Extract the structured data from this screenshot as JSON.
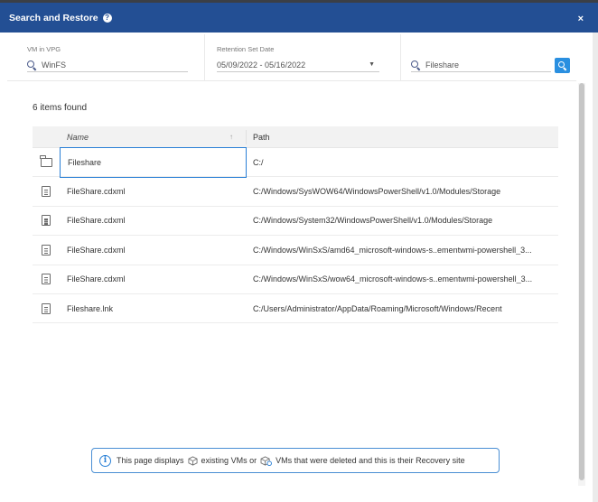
{
  "dialog": {
    "title": "Search and Restore",
    "help_glyph": "?",
    "close_glyph": "×"
  },
  "filters": {
    "vm_label": "VM in VPG",
    "vm_value": "WinFS",
    "date_label": "Retention Set Date",
    "date_value": "05/09/2022 - 05/16/2022",
    "search_value": "Fileshare"
  },
  "results": {
    "count_text": "6 items found",
    "columns": {
      "name": "Name",
      "path": "Path"
    },
    "rows": [
      {
        "type": "folder",
        "name": "Fileshare",
        "path": "C:/"
      },
      {
        "type": "file",
        "name": "FileShare.cdxml",
        "path": "C:/Windows/SysWOW64/WindowsPowerShell/v1.0/Modules/Storage"
      },
      {
        "type": "file",
        "name": "FileShare.cdxml",
        "path": "C:/Windows/System32/WindowsPowerShell/v1.0/Modules/Storage"
      },
      {
        "type": "file",
        "name": "FileShare.cdxml",
        "path": "C:/Windows/WinSxS/amd64_microsoft-windows-s..ementwmi-powershell_3..."
      },
      {
        "type": "file",
        "name": "FileShare.cdxml",
        "path": "C:/Windows/WinSxS/wow64_microsoft-windows-s..ementwmi-powershell_3..."
      },
      {
        "type": "file",
        "name": "Fileshare.lnk",
        "path": "C:/Users/Administrator/AppData/Roaming/Microsoft/Windows/Recent"
      }
    ]
  },
  "info": {
    "part1": "This page displays",
    "part2": "existing VMs or",
    "part3": "VMs that were deleted and this is their Recovery site"
  }
}
